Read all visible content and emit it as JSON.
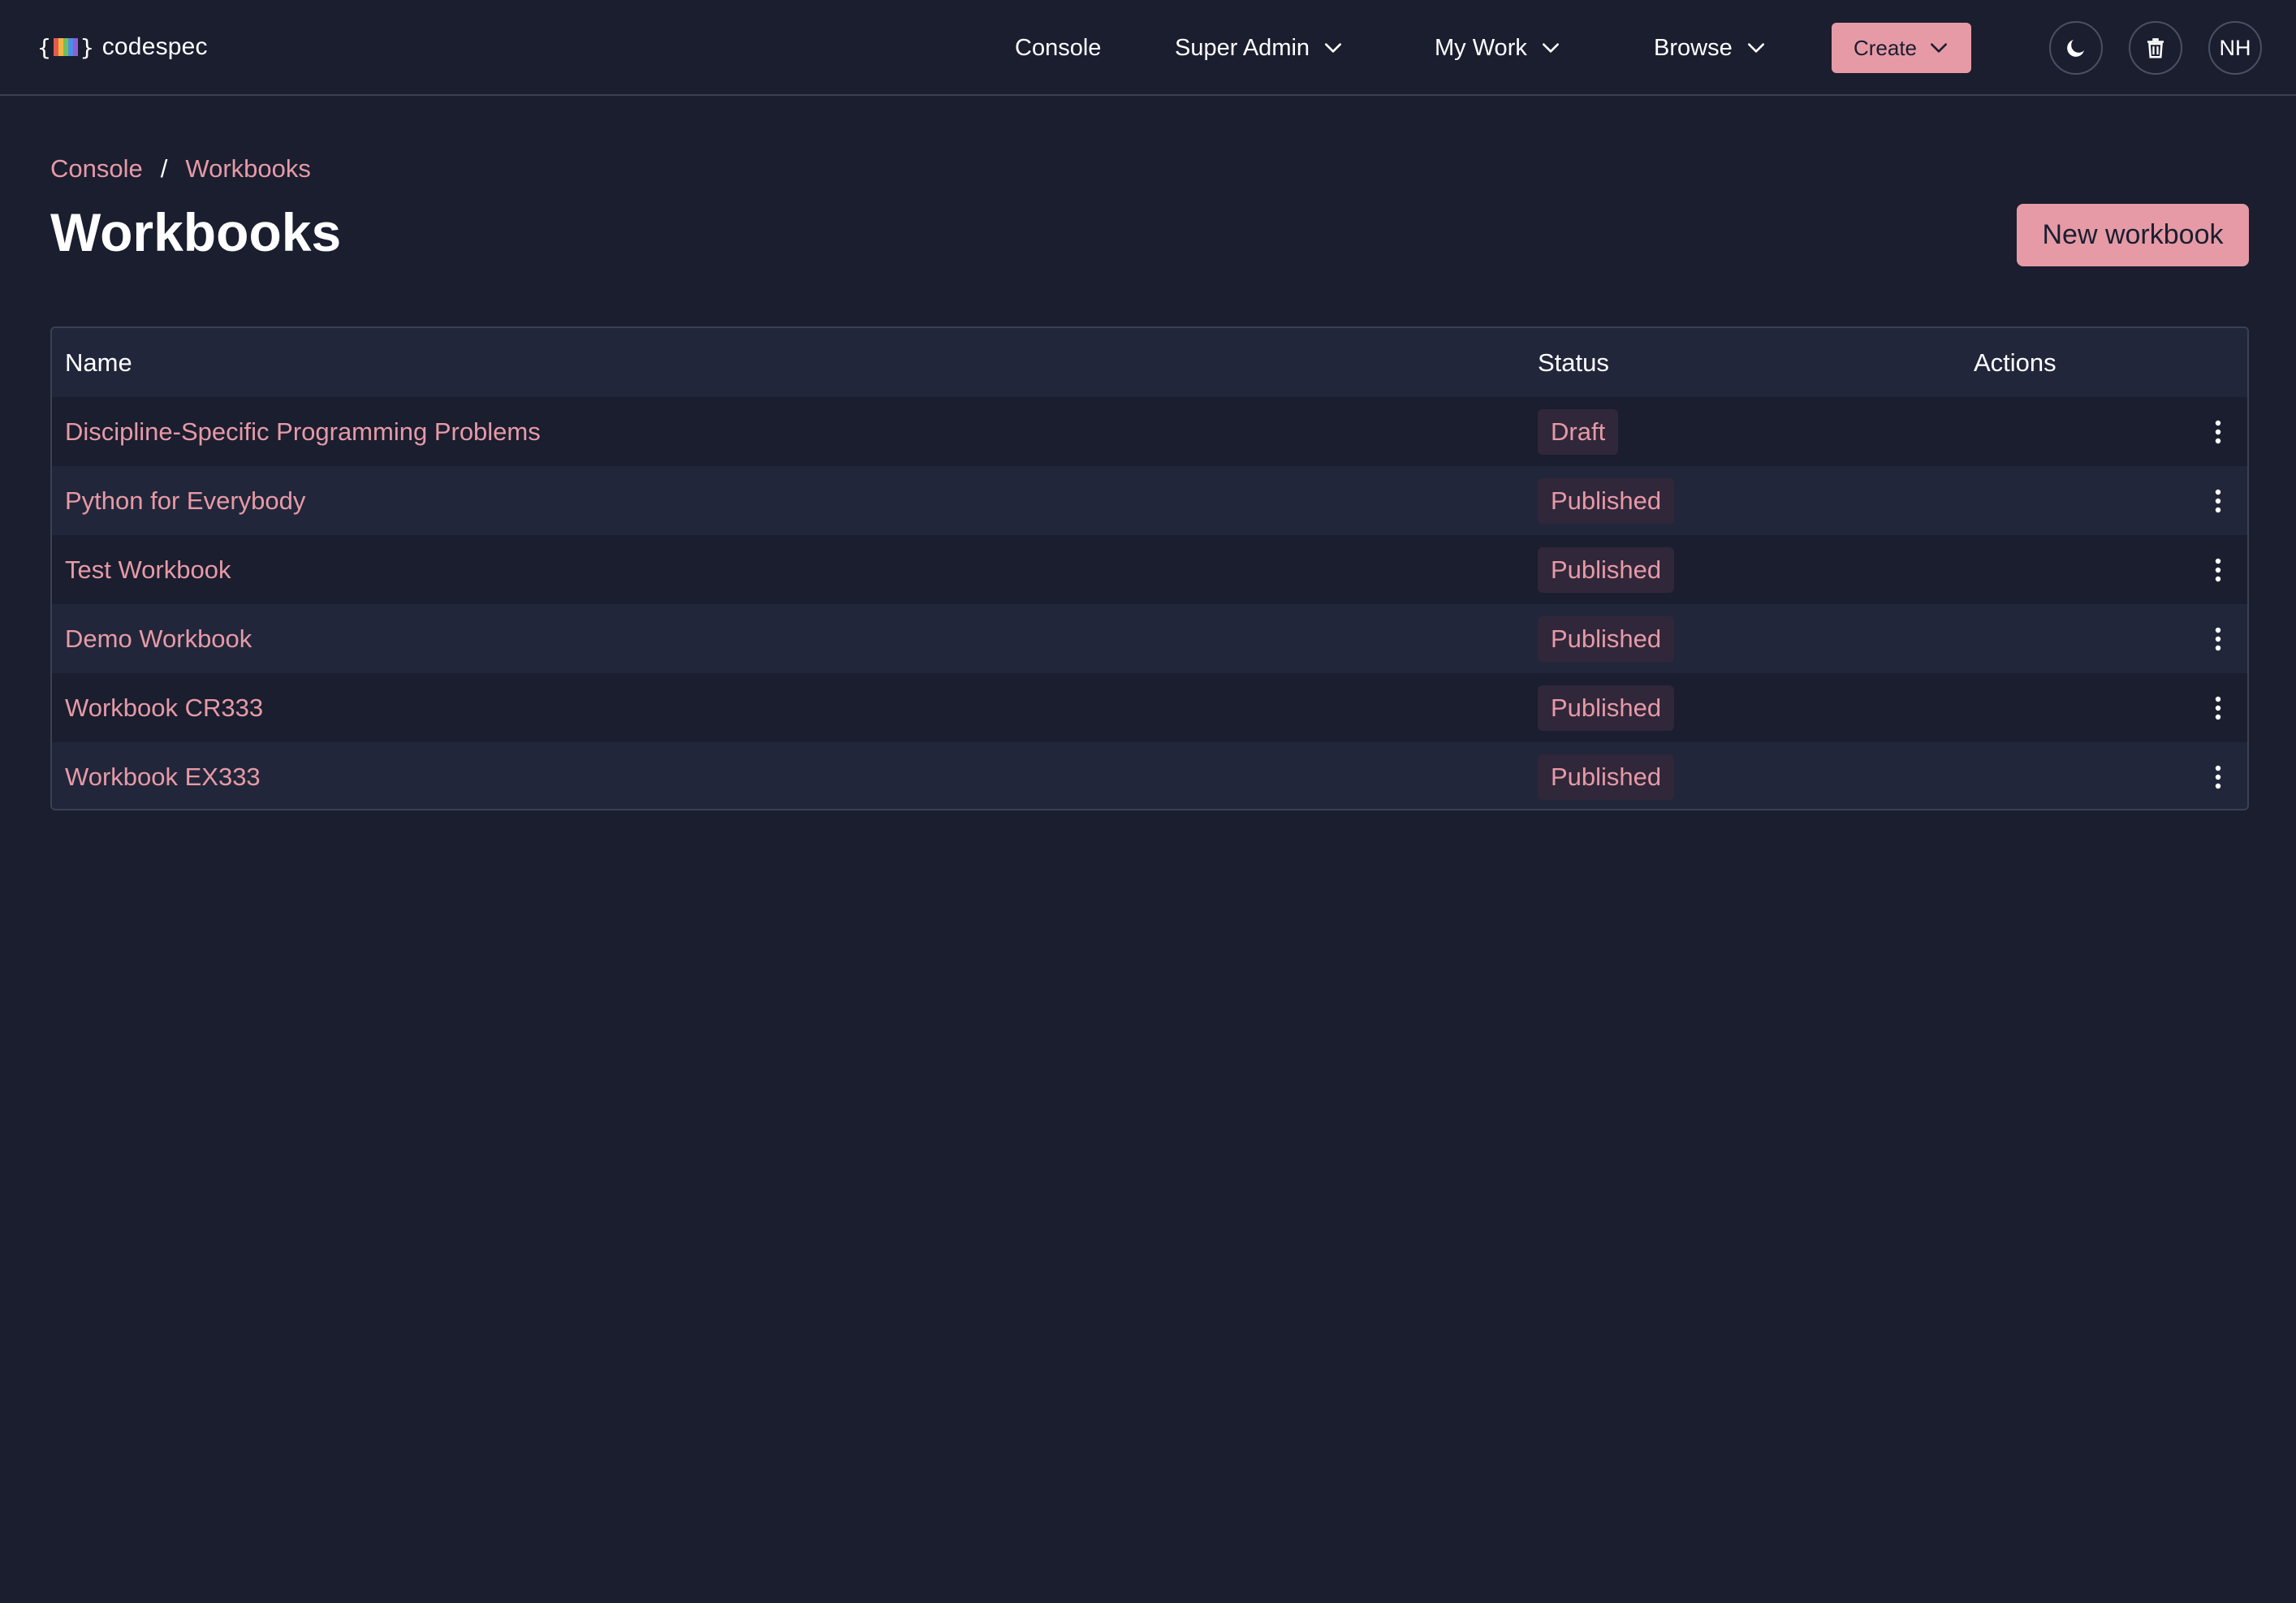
{
  "app": {
    "brand_open": "{",
    "brand_close": "}",
    "brand_name": "codespec",
    "brand_bar_colors": [
      "#e35b4f",
      "#f2b441",
      "#6fbf5b",
      "#4d8ee6",
      "#8b5fd6"
    ]
  },
  "nav": {
    "console": "Console",
    "super_admin": "Super Admin",
    "my_work": "My Work",
    "browse": "Browse",
    "create": "Create",
    "avatar_initials": "NH"
  },
  "breadcrumb": {
    "items": [
      "Console",
      "Workbooks"
    ],
    "separator": "/"
  },
  "page": {
    "title": "Workbooks",
    "new_button": "New workbook"
  },
  "table": {
    "columns": [
      "Name",
      "Status",
      "Actions"
    ],
    "rows": [
      {
        "name": "Discipline-Specific Programming Problems",
        "status": "Draft"
      },
      {
        "name": "Python for Everybody",
        "status": "Published"
      },
      {
        "name": "Test Workbook",
        "status": "Published"
      },
      {
        "name": "Demo Workbook",
        "status": "Published"
      },
      {
        "name": "Workbook CR333",
        "status": "Published"
      },
      {
        "name": "Workbook EX333",
        "status": "Published"
      }
    ]
  },
  "colors": {
    "background": "#1a1e2f",
    "accent": "#e69aa6",
    "badge_background": "#31273a",
    "row_alt": "#22263a",
    "border": "#3c4152"
  },
  "icons": {
    "theme_toggle": "moon-icon",
    "trash": "trash-icon",
    "row_menu": "kebab-menu-icon",
    "dropdown": "chevron-down-icon"
  }
}
